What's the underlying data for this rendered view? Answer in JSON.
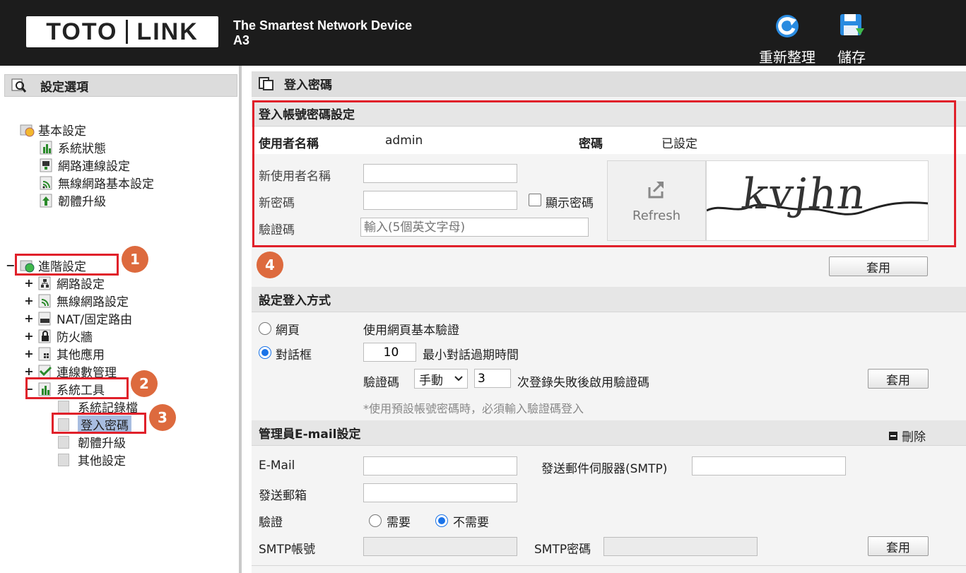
{
  "header": {
    "brand_left": "TOTO",
    "brand_right": "LINK",
    "tagline": "The Smartest Network Device",
    "model": "A3",
    "refresh_label": "重新整理",
    "save_label": "儲存"
  },
  "sidebar": {
    "title": "設定選項",
    "basic": {
      "label": "基本設定",
      "items": [
        "系統狀態",
        "網路連線設定",
        "無線網路基本設定",
        "韌體升級"
      ]
    },
    "advanced": {
      "toggle": "−",
      "label": "進階設定",
      "items": [
        {
          "toggle": "+",
          "label": "網路設定"
        },
        {
          "toggle": "+",
          "label": "無線網路設定"
        },
        {
          "toggle": "+",
          "label": "NAT/固定路由"
        },
        {
          "toggle": "+",
          "label": "防火牆"
        },
        {
          "toggle": "+",
          "label": "其他應用"
        },
        {
          "toggle": "+",
          "label": "連線數管理"
        },
        {
          "toggle": "−",
          "label": "系統工具"
        }
      ],
      "tools": [
        "系統記錄檔",
        "登入密碼",
        "韌體升級",
        "其他設定"
      ]
    },
    "badges": [
      "1",
      "2",
      "3"
    ]
  },
  "main": {
    "title": "登入密碼",
    "login_section": {
      "title": "登入帳號密碼設定",
      "username_label": "使用者名稱",
      "username_value": "admin",
      "password_label": "密碼",
      "password_value": "已設定",
      "new_username_label": "新使用者名稱",
      "new_password_label": "新密碼",
      "show_password_label": "顯示密碼",
      "captcha_label": "驗證碼",
      "captcha_placeholder": "輸入(5個英文字母)",
      "refresh_label": "Refresh",
      "captcha_text": "kvjhn",
      "badge": "4",
      "apply_label": "套用"
    },
    "login_method": {
      "title": "設定登入方式",
      "web_label": "網頁",
      "web_desc": "使用網頁基本驗證",
      "dialog_label": "對話框",
      "timeout_value": "10",
      "timeout_desc": "最小對話過期時間",
      "captcha_label": "驗證碼",
      "captcha_mode": "手動",
      "fail_count": "3",
      "fail_desc": "次登錄失敗後啟用驗證碼",
      "apply_label": "套用",
      "note": "*使用預設帳號密碼時，必須輸入驗證碼登入"
    },
    "email": {
      "title": "管理員E-mail設定",
      "delete_label": "刪除",
      "email_label": "E-Mail",
      "smtp_label": "發送郵件伺服器(SMTP)",
      "sender_label": "發送郵箱",
      "auth_label": "驗證",
      "auth_required": "需要",
      "auth_not_required": "不需要",
      "smtp_account_label": "SMTP帳號",
      "smtp_password_label": "SMTP密碼",
      "apply_label": "套用"
    }
  },
  "colors": {
    "header_bg": "#1c1c1c",
    "highlight_red": "#e0202a",
    "badge_orange": "#dd6a3e",
    "selected_bg": "#a8bde0"
  }
}
